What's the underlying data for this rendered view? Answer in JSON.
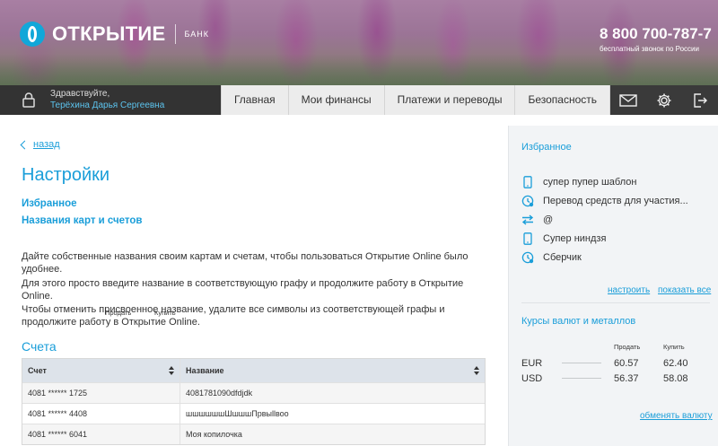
{
  "header": {
    "logo_text": "ОТКРЫТИЕ",
    "logo_subtext": "БАНК",
    "phone_number": "8 800 700-787-7",
    "phone_note": "бесплатный звонок по России",
    "colors": {
      "brand": "#11a7d9",
      "navbar": "#3a3a3a",
      "link": "#1a9ed9"
    }
  },
  "nav": {
    "greeting": "Здравствуйте,",
    "user_name": "Терёхина Дарья Сергеевна",
    "tabs": [
      {
        "label": "Главная"
      },
      {
        "label": "Мои финансы"
      },
      {
        "label": "Платежи и переводы"
      },
      {
        "label": "Безопасность"
      }
    ],
    "icons": [
      "mail-icon",
      "gear-icon",
      "logout-icon"
    ]
  },
  "main": {
    "back_label": "назад",
    "title": "Настройки",
    "links": [
      {
        "label": "Избранное"
      },
      {
        "label": "Названия карт и счетов"
      }
    ],
    "paragraphs": [
      "Дайте собственные названия своим картам и счетам, чтобы пользоваться Открытие Online было удобнее.",
      "Для этого просто введите название в соответствующую графу и продолжите работу в Открытие Online.",
      "Чтобы отменить присвоенное название, удалите все символы из соответствующей графы и продолжите работу в Открытие Online."
    ],
    "accounts_title": "Счета",
    "table": {
      "columns": [
        "Счет",
        "Название"
      ],
      "rows": [
        [
          "4081 ****** 1725",
          "4081781090dfdjdk"
        ],
        [
          "4081 ****** 4408",
          "шшшшшшШшшшПрвыllвоо"
        ],
        [
          "4081 ****** 6041",
          "Моя копилочка"
        ]
      ]
    }
  },
  "sidebar": {
    "favorites_title": "Избранное",
    "favorites": [
      {
        "label": "супер пупер шаблон",
        "icon": "phone-icon"
      },
      {
        "label": "Перевод средств для участия...",
        "icon": "clock-refresh-icon"
      },
      {
        "label": "@",
        "icon": "transfer-arrows-icon"
      },
      {
        "label": "Супер ниндзя",
        "icon": "phone-icon"
      },
      {
        "label": "Сберчик",
        "icon": "clock-refresh-icon"
      }
    ],
    "configure_label": "настроить",
    "show_all_label": "показать все",
    "rates_title": "Курсы валют и металлов",
    "rates_sell": "Продать",
    "rates_buy": "Купить",
    "rates": [
      {
        "currency": "EUR",
        "sell": "60.57",
        "buy": "62.40"
      },
      {
        "currency": "USD",
        "sell": "56.37",
        "buy": "58.08"
      }
    ],
    "exchange_label": "обменять валюту"
  }
}
